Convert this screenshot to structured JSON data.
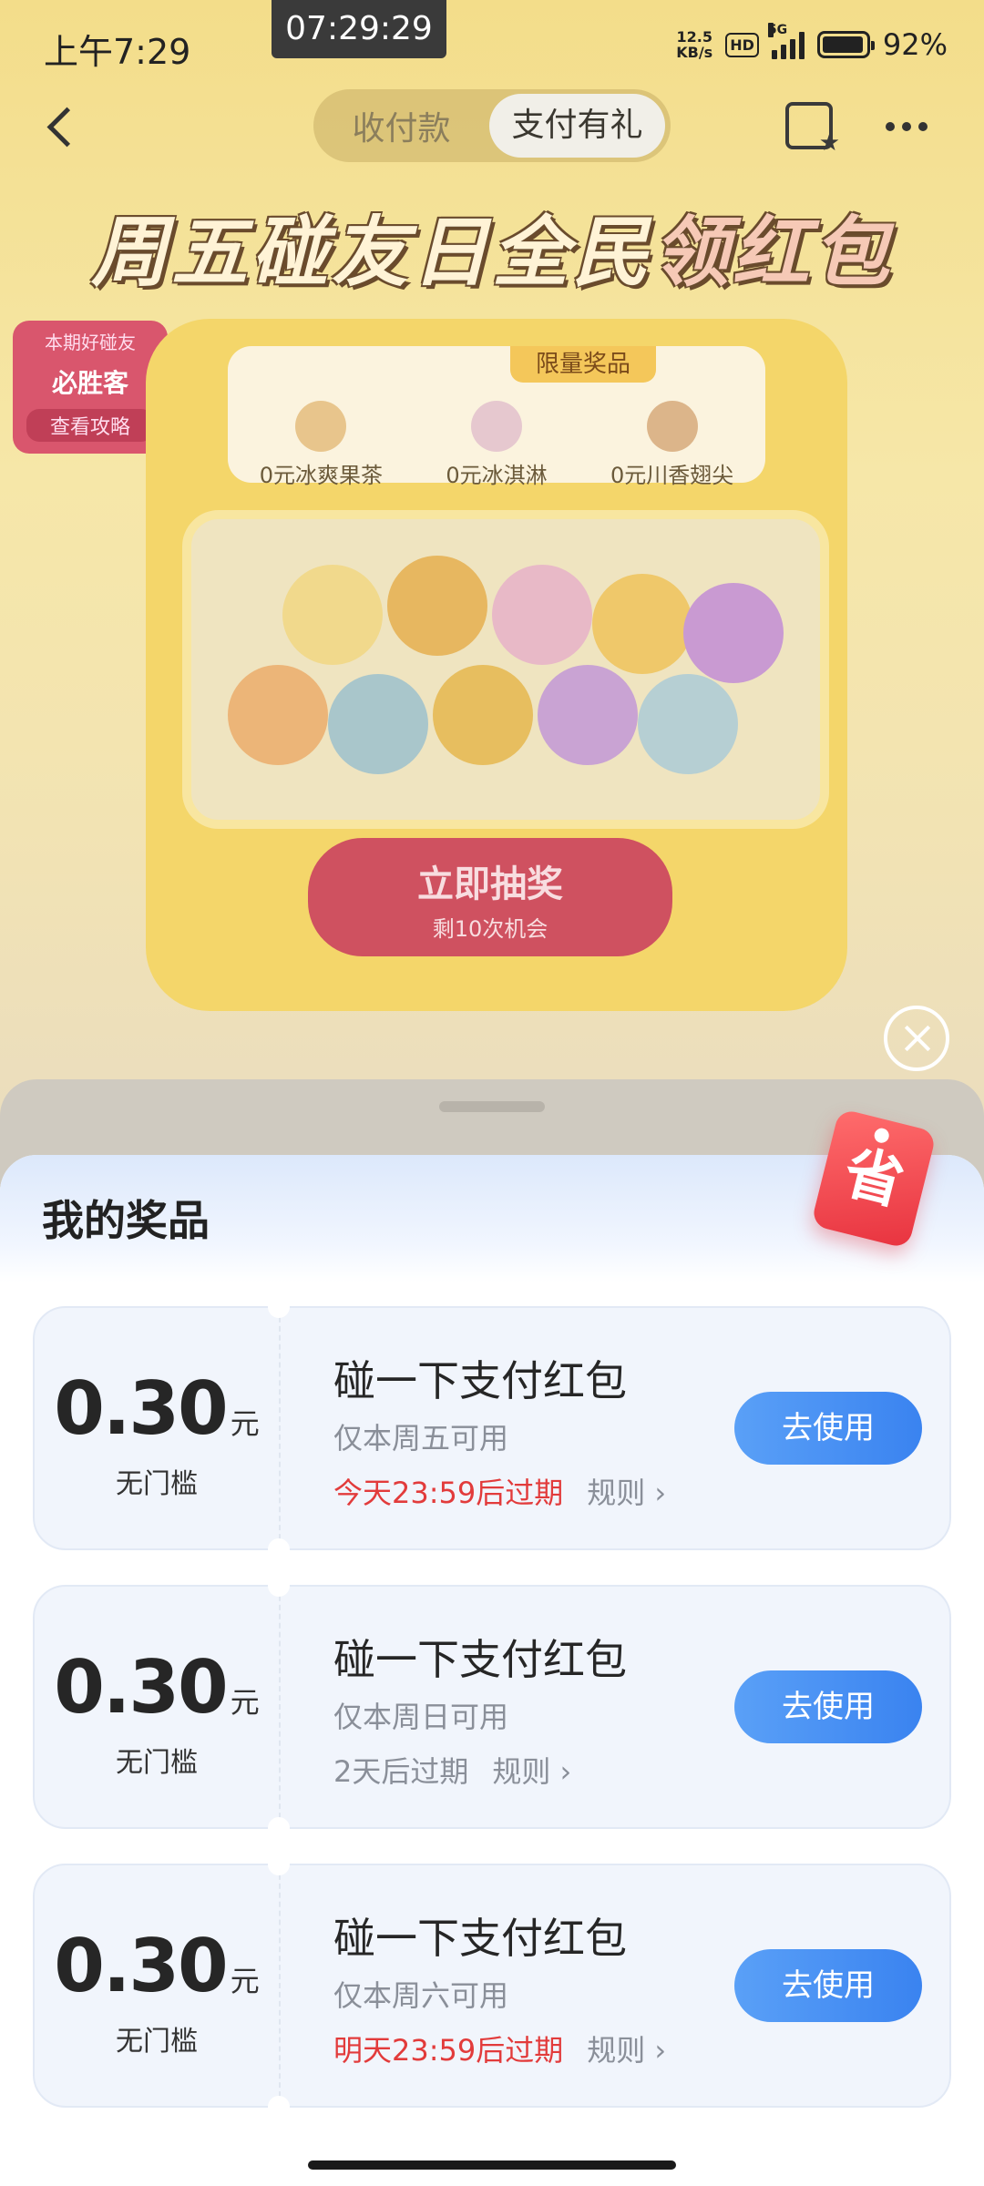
{
  "status_bar": {
    "time": "上午7:29",
    "center_clock": "07:29:29",
    "net_speed_value": "12.5",
    "net_speed_unit": "KB/s",
    "hd": "HD",
    "network": "5G",
    "battery": "92%"
  },
  "nav": {
    "tabs": [
      {
        "label": "收付款"
      },
      {
        "label": "支付有礼"
      }
    ]
  },
  "promo": {
    "title_main": "周五碰友日全民",
    "title_accent": "领红包",
    "friend_card": {
      "label": "本期好碰友",
      "brand": "必胜客",
      "link": "查看攻略"
    },
    "prize_header": "限量奖品",
    "prizes": [
      {
        "label": "0元冰爽果茶"
      },
      {
        "label": "0元冰淇淋"
      },
      {
        "label": "0元川香翅尖"
      }
    ],
    "draw_button": "立即抽奖",
    "draw_chances": "剩10次机会"
  },
  "sheet": {
    "title": "我的奖品",
    "tag_glyph": "省",
    "coupons": [
      {
        "amount": "0.30",
        "unit": "元",
        "threshold": "无门槛",
        "title": "碰一下支付红包",
        "availability": "仅本周五可用",
        "expiry": "今天23:59后过期",
        "expiry_color": "red",
        "rule": "规则 ›",
        "button": "去使用"
      },
      {
        "amount": "0.30",
        "unit": "元",
        "threshold": "无门槛",
        "title": "碰一下支付红包",
        "availability": "仅本周日可用",
        "expiry": "2天后过期",
        "expiry_color": "grey",
        "rule": "规则 ›",
        "button": "去使用"
      },
      {
        "amount": "0.30",
        "unit": "元",
        "threshold": "无门槛",
        "title": "碰一下支付红包",
        "availability": "仅本周六可用",
        "expiry": "明天23:59后过期",
        "expiry_color": "red",
        "rule": "规则 ›",
        "button": "去使用"
      }
    ]
  },
  "colors": {
    "accent_blue": "#3a83f0",
    "expiry_red": "#e23b3b",
    "coupon_bg": "#f1f5fc"
  }
}
